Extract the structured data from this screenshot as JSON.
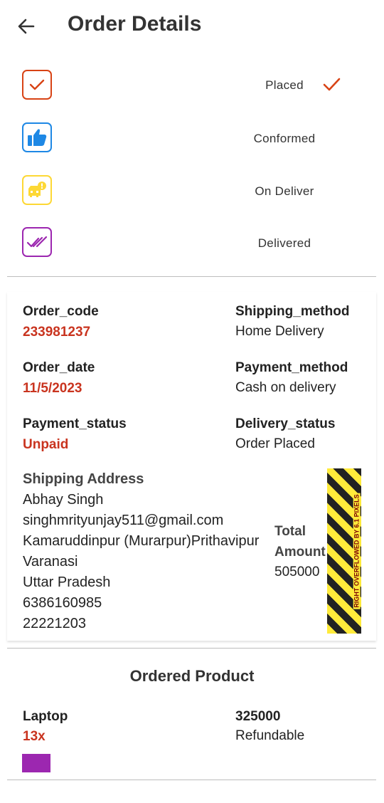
{
  "appbar": {
    "title": "Order Details",
    "back_icon": "arrow-left-icon"
  },
  "steps": [
    {
      "label": "Placed",
      "icon": "check-icon",
      "color": "#d84315",
      "completed": true
    },
    {
      "label": "Conformed",
      "icon": "thumb-up-icon",
      "color": "#1e88e5"
    },
    {
      "label": "On Deliver",
      "icon": "delivery-car-icon",
      "color": "#fdd835"
    },
    {
      "label": "Delivered",
      "icon": "double-check-icon",
      "color": "#9c27b0"
    }
  ],
  "order": {
    "code_label": "Order_code",
    "code": "233981237",
    "date_label": "Order_date",
    "date": "11/5/2023",
    "payment_status_label": "Payment_status",
    "payment_status": "Unpaid",
    "shipping_method_label": "Shipping_method",
    "shipping_method": "Home Delivery",
    "payment_method_label": "Payment_method",
    "payment_method": "Cash on delivery",
    "delivery_status_label": "Delivery_status",
    "delivery_status": "Order Placed"
  },
  "address": {
    "title": "Shipping Address",
    "lines": [
      "Abhay Singh",
      "singhmrityunjay511@gmail.com",
      "Kamaruddinpur (Murarpur)Prithavipur",
      "Varanasi",
      "Uttar Pradesh",
      "6386160985",
      "22221203"
    ]
  },
  "total": {
    "label_1": "Total",
    "label_2": "Amount",
    "value": "505000"
  },
  "overflow_warning": "RIGHT OVERFLOWED BY 6.1 PIXELS",
  "products": {
    "title": "Ordered Product",
    "items": [
      {
        "name": "Laptop",
        "qty": "13x",
        "price": "325000",
        "refund": "Refundable",
        "swatch_color": "#9c27b0"
      }
    ]
  },
  "colors": {
    "accent_red": "#c9341f",
    "divider": "#bdbdbd"
  }
}
